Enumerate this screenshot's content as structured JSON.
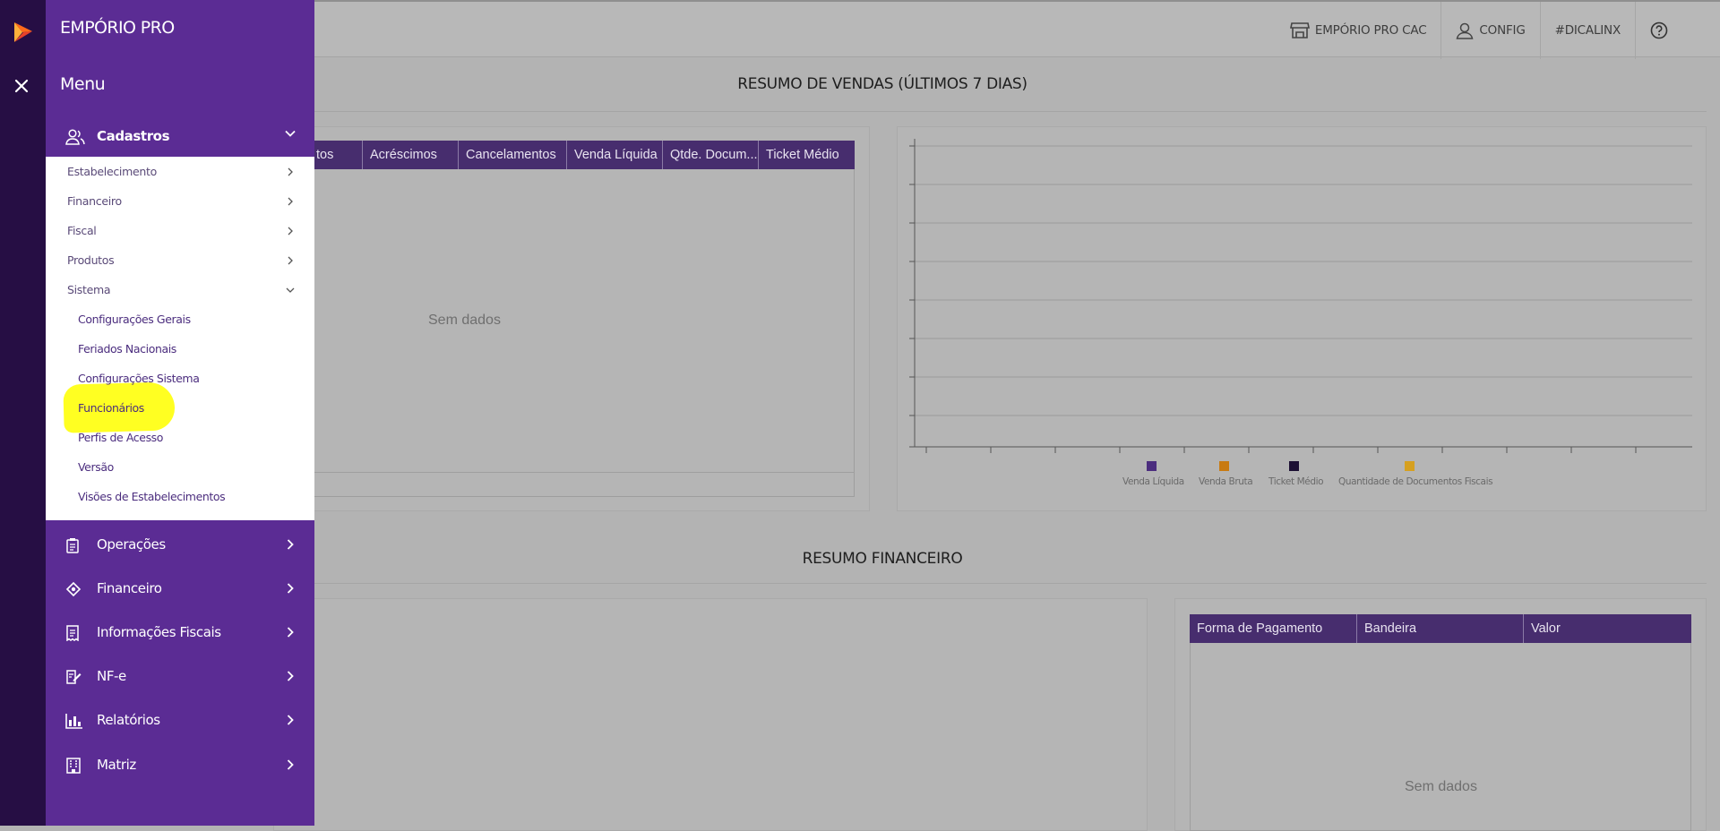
{
  "topbar": {
    "items": [
      {
        "label": "EMPÓRIO PRO CAC",
        "icon": "store-icon"
      },
      {
        "label": "CONFIG",
        "icon": "user-icon"
      },
      {
        "label": "#DICALINX",
        "icon": ""
      },
      {
        "label": "",
        "icon": "help-circle-icon"
      }
    ]
  },
  "sales": {
    "title": "RESUMO DE VENDAS (ÚLTIMOS 7 DIAS)",
    "columns": [
      "tos",
      "Acréscimos",
      "Cancelamentos",
      "Venda Líquida",
      "Qtde. Docum...",
      "Ticket Médio"
    ],
    "empty": "Sem dados"
  },
  "chart_data": {
    "type": "bar",
    "categories": [],
    "series": [
      {
        "name": "Venda Líquida",
        "values": [],
        "color": "#4b2d7e"
      },
      {
        "name": "Venda Bruta",
        "values": [],
        "color": "#c87a12"
      },
      {
        "name": "Ticket Médio",
        "values": [],
        "color": "#1c0f33"
      },
      {
        "name": "Quantidade de Documentos Fiscais",
        "values": [],
        "color": "#d6a020"
      }
    ],
    "grid": true,
    "legend": "bottom"
  },
  "finance": {
    "title": "RESUMO FINANCEIRO",
    "columns": [
      "Forma de Pagamento",
      "Bandeira",
      "Valor"
    ],
    "empty": "Sem dados"
  },
  "sidebar": {
    "brand": "EMPÓRIO PRO",
    "menu_title": "Menu",
    "cadastros": {
      "label": "Cadastros",
      "items": [
        {
          "label": "Estabelecimento"
        },
        {
          "label": "Financeiro"
        },
        {
          "label": "Fiscal"
        },
        {
          "label": "Produtos"
        },
        {
          "label": "Sistema"
        }
      ],
      "sistema_items": [
        {
          "label": "Configurações Gerais"
        },
        {
          "label": "Feriados Nacionais"
        },
        {
          "label": "Configurações Sistema"
        },
        {
          "label": "Funcionários"
        },
        {
          "label": "Perfis de Acesso"
        },
        {
          "label": "Versão"
        },
        {
          "label": "Visões de Estabelecimentos"
        }
      ]
    },
    "groups": [
      {
        "label": "Operações",
        "icon": "clipboard-icon"
      },
      {
        "label": "Financeiro",
        "icon": "money-icon"
      },
      {
        "label": "Informações Fiscais",
        "icon": "receipt-icon"
      },
      {
        "label": "NF-e",
        "icon": "document-edit-icon"
      },
      {
        "label": "Relatórios",
        "icon": "bar-chart-icon"
      },
      {
        "label": "Matriz",
        "icon": "building-icon"
      }
    ]
  }
}
